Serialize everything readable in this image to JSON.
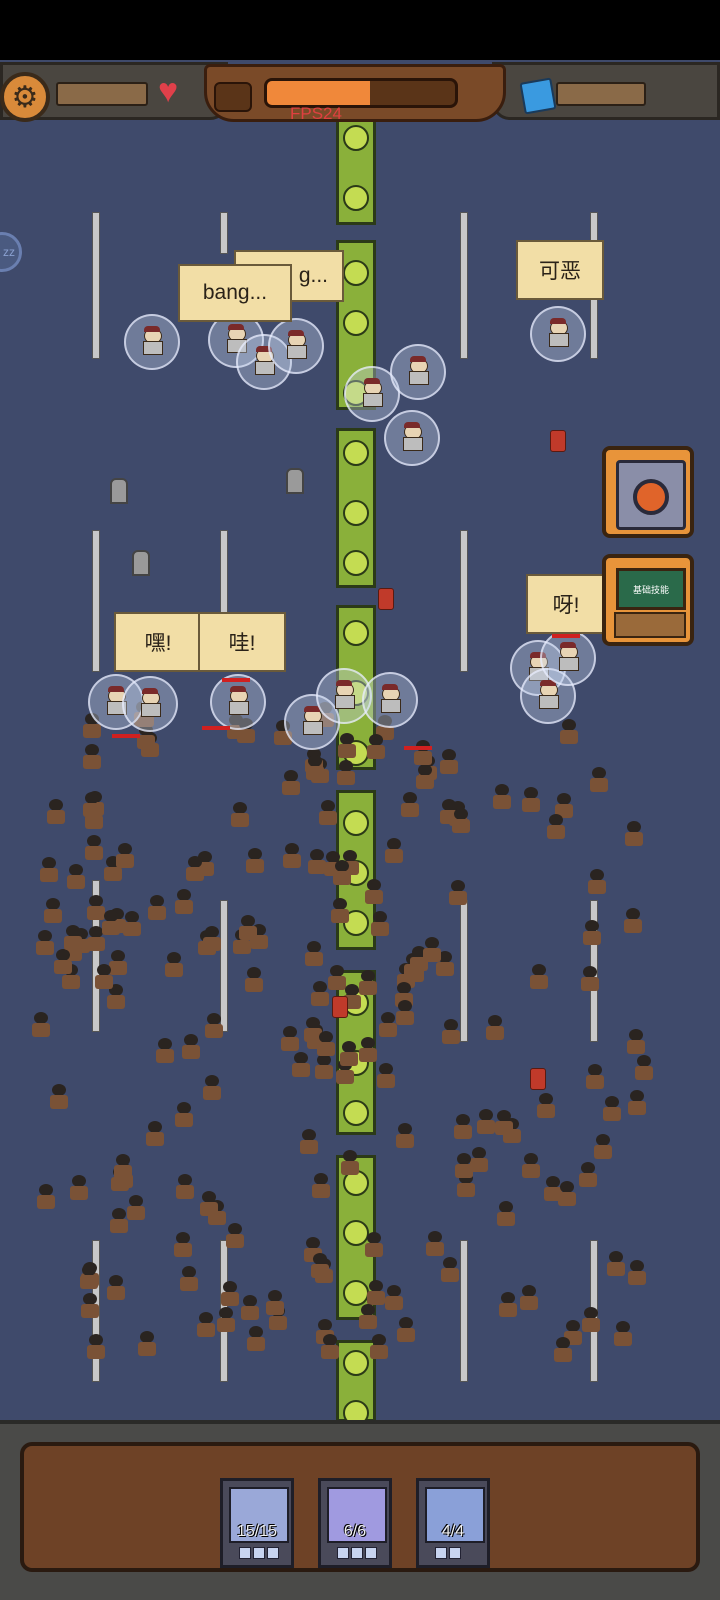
{
  "hud": {
    "fps": "FPS24",
    "wave_progress": 0.55,
    "heart_color": "#e0404a",
    "gem_color": "#3a9ae0",
    "icons": [
      "gear-icon",
      "heart-icon",
      "gem-icon"
    ]
  },
  "speech": {
    "b1": "bang...",
    "b2": "g...",
    "b3": "可恶",
    "b4": "嘿!",
    "b5": "哇!",
    "b6": "呀!"
  },
  "skills": {
    "skill2_board": "基础技能"
  },
  "units": [
    {
      "name": "swordsman",
      "count": "15/15"
    },
    {
      "name": "spartan",
      "count": "6/6"
    },
    {
      "name": "gunner",
      "count": "4/4"
    }
  ]
}
